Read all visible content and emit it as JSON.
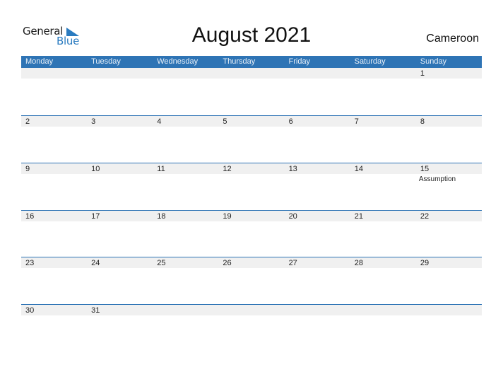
{
  "logo": {
    "line1": "General",
    "line2": "Blue"
  },
  "title": "August 2021",
  "country": "Cameroon",
  "weekdays": [
    "Monday",
    "Tuesday",
    "Wednesday",
    "Thursday",
    "Friday",
    "Saturday",
    "Sunday"
  ],
  "weeks": [
    {
      "days": [
        "",
        "",
        "",
        "",
        "",
        "",
        "1"
      ],
      "holidays": [
        "",
        "",
        "",
        "",
        "",
        "",
        ""
      ]
    },
    {
      "days": [
        "2",
        "3",
        "4",
        "5",
        "6",
        "7",
        "8"
      ],
      "holidays": [
        "",
        "",
        "",
        "",
        "",
        "",
        ""
      ]
    },
    {
      "days": [
        "9",
        "10",
        "11",
        "12",
        "13",
        "14",
        "15"
      ],
      "holidays": [
        "",
        "",
        "",
        "",
        "",
        "",
        "Assumption"
      ]
    },
    {
      "days": [
        "16",
        "17",
        "18",
        "19",
        "20",
        "21",
        "22"
      ],
      "holidays": [
        "",
        "",
        "",
        "",
        "",
        "",
        ""
      ]
    },
    {
      "days": [
        "23",
        "24",
        "25",
        "26",
        "27",
        "28",
        "29"
      ],
      "holidays": [
        "",
        "",
        "",
        "",
        "",
        "",
        ""
      ]
    },
    {
      "days": [
        "30",
        "31",
        "",
        "",
        "",
        "",
        ""
      ],
      "holidays": [
        "",
        "",
        "",
        "",
        "",
        "",
        ""
      ]
    }
  ],
  "colors": {
    "header_bg": "#2e74b5",
    "strip_bg": "#f0f0f0",
    "logo_blue": "#2a7bc0"
  }
}
